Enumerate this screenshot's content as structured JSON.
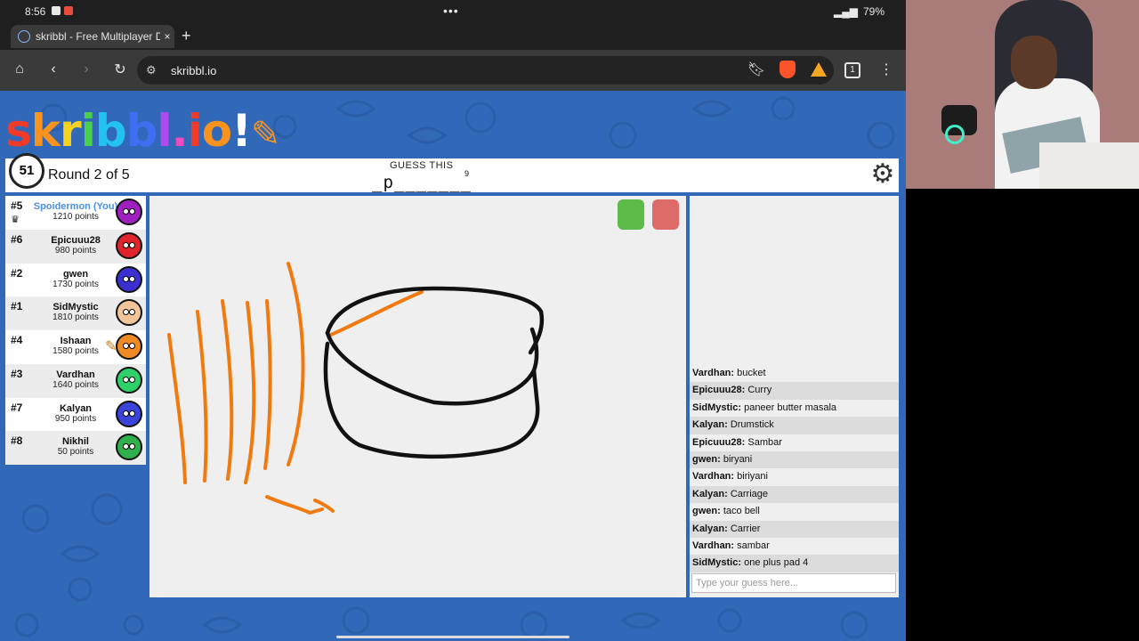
{
  "status_bar": {
    "time": "8:56",
    "battery": "79%"
  },
  "browser": {
    "tab_title": "skribbl - Free Multiplayer Dra",
    "tab_close": "×",
    "new_tab": "+",
    "url": "skribbl.io",
    "tab_count": "1"
  },
  "game": {
    "logo": "skribbl.io",
    "timer": "51",
    "round": "Round 2 of 5",
    "guess_label": "GUESS THIS",
    "word_hint": "_p_______",
    "word_length": "9"
  },
  "players": [
    {
      "rank": "#5",
      "name": "Spoidermon (You)",
      "points": "1210 points",
      "color": "#a01fbf",
      "you": true
    },
    {
      "rank": "#6",
      "name": "Epicuuu28",
      "points": "980 points",
      "color": "#e0242d"
    },
    {
      "rank": "#2",
      "name": "gwen",
      "points": "1730 points",
      "color": "#3c2fcf"
    },
    {
      "rank": "#1",
      "name": "SidMystic",
      "points": "1810 points",
      "color": "#f2c49a"
    },
    {
      "rank": "#4",
      "name": "Ishaan",
      "points": "1580 points",
      "color": "#f08a24"
    },
    {
      "rank": "#3",
      "name": "Vardhan",
      "points": "1640 points",
      "color": "#2fd06a"
    },
    {
      "rank": "#7",
      "name": "Kalyan",
      "points": "950 points",
      "color": "#3a44d8"
    },
    {
      "rank": "#8",
      "name": "Nikhil",
      "points": "50 points",
      "color": "#2fb04c"
    }
  ],
  "chat": [
    {
      "user": "Vardhan:",
      "text": "bucket"
    },
    {
      "user": "Epicuuu28:",
      "text": "Curry"
    },
    {
      "user": "SidMystic:",
      "text": "paneer butter masala"
    },
    {
      "user": "Kalyan:",
      "text": "Drumstick"
    },
    {
      "user": "Epicuuu28:",
      "text": "Sambar"
    },
    {
      "user": "gwen:",
      "text": "biryani"
    },
    {
      "user": "Vardhan:",
      "text": "biriyani"
    },
    {
      "user": "Kalyan:",
      "text": "Carriage"
    },
    {
      "user": "gwen:",
      "text": "taco bell"
    },
    {
      "user": "Kalyan:",
      "text": "Carrier"
    },
    {
      "user": "Vardhan:",
      "text": "sambar"
    },
    {
      "user": "SidMystic:",
      "text": "one plus pad 4"
    }
  ],
  "chat_input_placeholder": "Type your guess here...",
  "colors": {
    "page_bg": "#3168b8",
    "drawing_orange": "#f07a10",
    "drawing_black": "#111111"
  }
}
